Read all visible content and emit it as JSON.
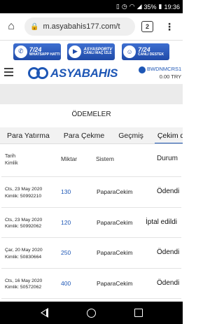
{
  "status_bar": {
    "battery": "35%",
    "time": "19:36"
  },
  "browser": {
    "url": "m.asyabahis177.com/t",
    "tab_count": "2"
  },
  "banners": [
    {
      "big": "7/24",
      "small": "WHATSAPP HATTI"
    },
    {
      "big": "ASYASPORTV",
      "small": "CANLI MAÇ İZLE"
    },
    {
      "big": "7/24",
      "small": "CANLI DESTEK"
    }
  ],
  "header": {
    "logo_text": "ASYABAHIS",
    "username": "BWDNMCRS1",
    "balance": "0.00 TRY"
  },
  "page": {
    "title": "ÖDEMELER"
  },
  "tabs": [
    "Para Yatırma",
    "Para Çekme",
    "Geçmiş",
    "Çekim du"
  ],
  "table": {
    "headers": {
      "tarih": "Tarih",
      "kimlik": "Kimlik",
      "miktar": "Miktar",
      "sistem": "Sistem",
      "durum": "Durum"
    },
    "rows": [
      {
        "date": "Cts, 23 May 2020",
        "kimlik": "Kimlik: 50992210",
        "amount": "130",
        "system": "PaparaCekim",
        "status": "Ödendi"
      },
      {
        "date": "Cts, 23 May 2020",
        "kimlik": "Kimlik: 50992062",
        "amount": "120",
        "system": "PaparaCekim",
        "status": "İptal edildi"
      },
      {
        "date": "Çar, 20 May 2020",
        "kimlik": "Kimlik: 50830664",
        "amount": "250",
        "system": "PaparaCekim",
        "status": "Ödendi"
      },
      {
        "date": "Cts, 16 May 2020",
        "kimlik": "Kimlik: 50572062",
        "amount": "400",
        "system": "PaparaCekim",
        "status": "Ödendi"
      }
    ]
  }
}
